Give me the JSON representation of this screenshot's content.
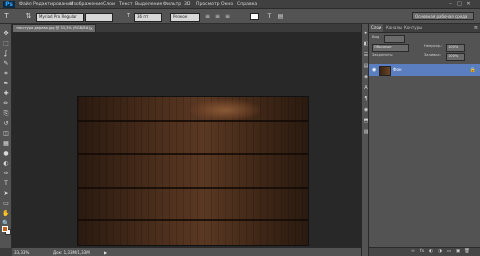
{
  "app": {
    "logo": "Ps"
  },
  "menu": [
    "Файл",
    "Редактирование",
    "Изображение",
    "Слои",
    "Текст",
    "Выделение",
    "Фильтр",
    "3D",
    "Просмотр",
    "Окно",
    "Справка"
  ],
  "window_controls": {
    "minimize": "–",
    "maximize": "□",
    "close": "✕"
  },
  "options": {
    "tool_icon": "T",
    "orientation_icon": "⇅",
    "font_family": "Myriad Pro",
    "font_style": "Regular",
    "font_size": "36 пт",
    "antialias": "Резкое",
    "align_left": "≡",
    "align_center": "≡",
    "align_right": "≡",
    "color_swatch": "#ffffff",
    "warp_icon": "T",
    "panels_icon": "▤",
    "workspace": "Основная рабочая среда"
  },
  "document": {
    "tab_title": "текстура дерева.jpg @ 33,3% (RGB/8#)",
    "close": "×"
  },
  "tools": [
    "move-tool",
    "marquee-tool",
    "lasso-tool",
    "quick-select-tool",
    "crop-tool",
    "eyedropper-tool",
    "healing-tool",
    "brush-tool",
    "clone-tool",
    "history-brush-tool",
    "eraser-tool",
    "gradient-tool",
    "blur-tool",
    "dodge-tool",
    "pen-tool",
    "type-tool",
    "path-select-tool",
    "shape-tool",
    "hand-tool",
    "zoom-tool"
  ],
  "tool_glyphs": [
    "✥",
    "⬚",
    "ʆ",
    "✎",
    "⌗",
    "✒",
    "✚",
    "✏",
    "⎘",
    "↺",
    "◫",
    "▦",
    "●",
    "◐",
    "✑",
    "T",
    "➤",
    "▭",
    "✋",
    "🔍"
  ],
  "colors": {
    "foreground": "#c8621c",
    "background": "#ffffff"
  },
  "status": {
    "zoom": "33,33%",
    "doc_info": "Док: 1,33M/1,33M",
    "arrow": "▶"
  },
  "panel_strip_icons": [
    "▸",
    "◧",
    "☰",
    "▤",
    "◈",
    "A",
    "¶",
    "◉",
    "⬒",
    "▨"
  ],
  "layers_panel": {
    "tabs": [
      "Слои",
      "Каналы",
      "Контуры"
    ],
    "menu_icon": "≡",
    "kind_label": "Вид",
    "blend_mode": "Обычные",
    "opacity_label": "Непрозр.:",
    "opacity_value": "100%",
    "lock_label": "Закрепить:",
    "fill_label": "Заливка:",
    "fill_value": "100%",
    "layer": {
      "name": "Фон",
      "eye": "◉",
      "lock": "🔒"
    },
    "footer_icons": [
      "∞",
      "fx",
      "◐",
      "◑",
      "▭",
      "▣",
      "🗑"
    ]
  }
}
